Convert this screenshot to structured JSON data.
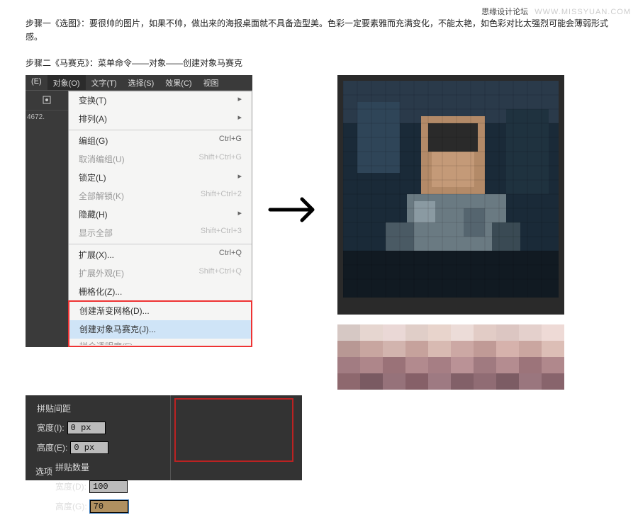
{
  "header": {
    "site": "思缘设计论坛",
    "url": "WWW.MISSYUAN.COM"
  },
  "step1": "步骤一《选图》：要很帅的图片，如果不帅，做出来的海报桌面就不具备造型美。色彩一定要素雅而充满变化，不能太艳，如色彩对比太强烈可能会薄弱形式感。",
  "step2": "步骤二《马赛克》：菜单命令——对象——创建对象马赛克",
  "menubar": {
    "items": [
      "(E)",
      "对象(O)",
      "文字(T)",
      "选择(S)",
      "效果(C)",
      "视图"
    ]
  },
  "side": {
    "num": "4672."
  },
  "dropdown": {
    "items": [
      {
        "label": "变换(T)",
        "arrow": true
      },
      {
        "label": "排列(A)",
        "arrow": true
      },
      {
        "sep": true
      },
      {
        "label": "编组(G)",
        "sc": "Ctrl+G"
      },
      {
        "label": "取消编组(U)",
        "sc": "Shift+Ctrl+G",
        "disabled": true
      },
      {
        "label": "锁定(L)",
        "arrow": true
      },
      {
        "label": "全部解锁(K)",
        "sc": "Shift+Ctrl+2",
        "disabled": true
      },
      {
        "label": "隐藏(H)",
        "arrow": true
      },
      {
        "label": "显示全部",
        "sc": "Shift+Ctrl+3",
        "disabled": true
      },
      {
        "sep": true
      },
      {
        "label": "扩展(X)...",
        "sc": "Ctrl+Q"
      },
      {
        "label": "扩展外观(E)",
        "sc": "Shift+Ctrl+Q",
        "disabled": true
      },
      {
        "label": "栅格化(Z)..."
      },
      {
        "label": "创建渐变网格(D)..."
      },
      {
        "label": "创建对象马赛克(J)...",
        "selected": true
      },
      {
        "label": "拼合透明度(F)",
        "disabled": true
      }
    ]
  },
  "panel": {
    "left_title": "拼贴间距",
    "left_w_label": "宽度(I):",
    "left_w_val": "0 px",
    "left_h_label": "高度(E):",
    "left_h_val": "0 px",
    "right_title": "拼贴数量",
    "right_w_label": "宽度(D):",
    "right_w_val": "100",
    "right_h_label": "高度(G):",
    "right_h_val": "70",
    "footer": "选项"
  }
}
